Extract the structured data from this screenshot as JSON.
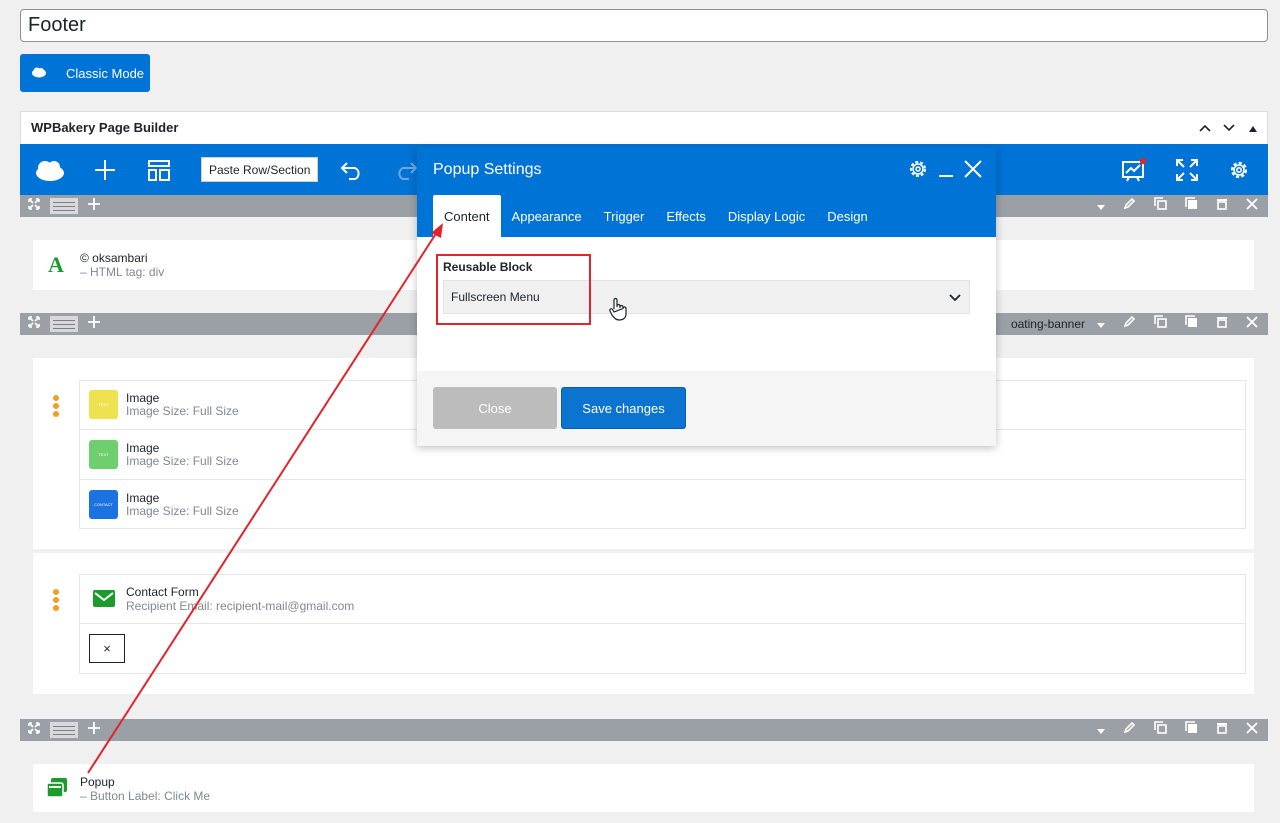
{
  "page": {
    "title_value": "Footer",
    "classic_mode_label": "Classic Mode"
  },
  "builder": {
    "title": "WPBakery Page Builder",
    "paste_label": "Paste Row/Section"
  },
  "rows": {
    "row1": {
      "text_title": "© oksambari",
      "text_sub": "– HTML tag: div"
    },
    "row2": {
      "label_fragment": "oating-banner",
      "images": [
        {
          "title": "Image",
          "sub": "Image Size: Full Size",
          "color": "#eee24f",
          "thumb_text": "TEXT"
        },
        {
          "title": "Image",
          "sub": "Image Size: Full Size",
          "color": "#6ecf6e",
          "thumb_text": "TEXT"
        },
        {
          "title": "Image",
          "sub": "Image Size: Full Size",
          "color": "#1a73e0",
          "thumb_text": "CONTACT"
        }
      ],
      "contact_title": "Contact Form",
      "contact_sub": "Recipient Email: recipient-mail@gmail.com",
      "x_glyph": "×"
    },
    "row3": {
      "popup_title": "Popup",
      "popup_sub": "– Button Label: Click Me"
    }
  },
  "modal": {
    "title": "Popup Settings",
    "tabs": [
      "Content",
      "Appearance",
      "Trigger",
      "Effects",
      "Display Logic",
      "Design"
    ],
    "active_tab": "Content",
    "field_label": "Reusable Block",
    "select_value": "Fullscreen Menu",
    "close_label": "Close",
    "save_label": "Save changes"
  },
  "colors": {
    "brand_blue": "#0073d6",
    "annotation_red": "#e0252c",
    "accent_green": "#1e9b2d",
    "drag_orange": "#f0a01e"
  },
  "icons": [
    "cloud-icon",
    "plus-icon",
    "layout-icon",
    "undo-icon",
    "redo-icon",
    "gear-icon",
    "minimize-icon",
    "close-icon",
    "chart-icon",
    "fullscreen-icon",
    "pencil-icon",
    "copy-icon",
    "trash-icon",
    "chevron-down-icon",
    "pointer-hand-icon",
    "envelope-icon",
    "text-icon",
    "popup-icon"
  ]
}
